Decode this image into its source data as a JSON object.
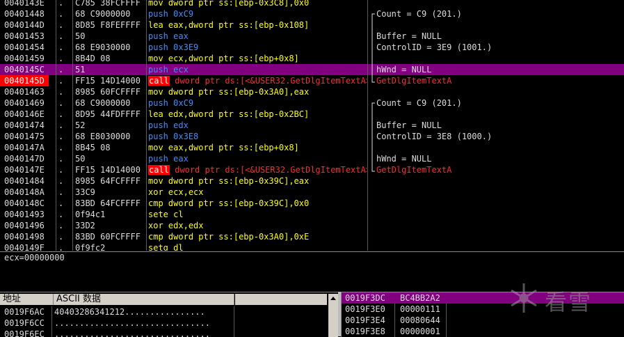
{
  "disasm": {
    "rows": [
      {
        "addr": "0040143E",
        "mark": ".",
        "hex": "C785 38FCFFFF",
        "op": "mov",
        "args": "dword ptr ss:[ebp-0x3C8],0x0",
        "cls": "mov",
        "cmt": ""
      },
      {
        "addr": "00401448",
        "mark": ".",
        "hex": "68 C9000000",
        "op": "push",
        "args": "0xC9",
        "cls": "push",
        "cmt": "Count = C9 (201.)"
      },
      {
        "addr": "0040144D",
        "mark": ".",
        "hex": "8D85 F8FEFFFF",
        "op": "lea",
        "args": "eax,dword ptr ss:[ebp-0x108]",
        "cls": "mov",
        "cmt": ""
      },
      {
        "addr": "00401453",
        "mark": ".",
        "hex": "50",
        "op": "push",
        "args": "eax",
        "cls": "push",
        "cmt": "Buffer = NULL"
      },
      {
        "addr": "00401454",
        "mark": ".",
        "hex": "68 E9030000",
        "op": "push",
        "args": "0x3E9",
        "cls": "push",
        "cmt": "ControlID = 3E9 (1001.)"
      },
      {
        "addr": "00401459",
        "mark": ".",
        "hex": "8B4D 08",
        "op": "mov",
        "args": "ecx,dword ptr ss:[ebp+0x8]",
        "cls": "mov",
        "cmt": ""
      },
      {
        "addr": "0040145C",
        "mark": ".",
        "hex": "51",
        "op": "push",
        "args": "ecx",
        "cls": "push",
        "cmt": "hWnd = NULL"
      },
      {
        "addr": "0040145D",
        "mark": ".",
        "hex": "FF15 14D14000",
        "op": "call",
        "args": "dword ptr ds:[<&USER32.GetDlgItemTextA>]",
        "cls": "call",
        "cmt": "GetDlgItemTextA"
      },
      {
        "addr": "00401463",
        "mark": ".",
        "hex": "8985 60FCFFFF",
        "op": "mov",
        "args": "dword ptr ss:[ebp-0x3A0],eax",
        "cls": "mov",
        "cmt": ""
      },
      {
        "addr": "00401469",
        "mark": ".",
        "hex": "68 C9000000",
        "op": "push",
        "args": "0xC9",
        "cls": "push",
        "cmt": "Count = C9 (201.)"
      },
      {
        "addr": "0040146E",
        "mark": ".",
        "hex": "8D95 44FDFFFF",
        "op": "lea",
        "args": "edx,dword ptr ss:[ebp-0x2BC]",
        "cls": "mov",
        "cmt": ""
      },
      {
        "addr": "00401474",
        "mark": ".",
        "hex": "52",
        "op": "push",
        "args": "edx",
        "cls": "push",
        "cmt": "Buffer = NULL"
      },
      {
        "addr": "00401475",
        "mark": ".",
        "hex": "68 E8030000",
        "op": "push",
        "args": "0x3E8",
        "cls": "push",
        "cmt": "ControlID = 3E8 (1000.)"
      },
      {
        "addr": "0040147A",
        "mark": ".",
        "hex": "8B45 08",
        "op": "mov",
        "args": "eax,dword ptr ss:[ebp+0x8]",
        "cls": "mov",
        "cmt": ""
      },
      {
        "addr": "0040147D",
        "mark": ".",
        "hex": "50",
        "op": "push",
        "args": "eax",
        "cls": "push",
        "cmt": "hWnd = NULL"
      },
      {
        "addr": "0040147E",
        "mark": ".",
        "hex": "FF15 14D14000",
        "op": "call",
        "args": "dword ptr ds:[<&USER32.GetDlgItemTextA>]",
        "cls": "call",
        "cmt": "GetDlgItemTextA"
      },
      {
        "addr": "00401484",
        "mark": ".",
        "hex": "8985 64FCFFFF",
        "op": "mov",
        "args": "dword ptr ss:[ebp-0x39C],eax",
        "cls": "mov",
        "cmt": ""
      },
      {
        "addr": "0040148A",
        "mark": ".",
        "hex": "33C9",
        "op": "xor",
        "args": "ecx,ecx",
        "cls": "mov",
        "cmt": ""
      },
      {
        "addr": "0040148C",
        "mark": ".",
        "hex": "83BD 64FCFFFF",
        "op": "cmp",
        "args": "dword ptr ss:[ebp-0x39C],0x0",
        "cls": "mov",
        "cmt": ""
      },
      {
        "addr": "00401493",
        "mark": ".",
        "hex": "0f94c1",
        "op": "sete",
        "args": "cl",
        "cls": "mov",
        "cmt": ""
      },
      {
        "addr": "00401496",
        "mark": ".",
        "hex": "33D2",
        "op": "xor",
        "args": "edx,edx",
        "cls": "mov",
        "cmt": ""
      },
      {
        "addr": "00401498",
        "mark": ".",
        "hex": "83BD 60FCFFFF",
        "op": "cmp",
        "args": "dword ptr ss:[ebp-0x3A0],0xE",
        "cls": "mov",
        "cmt": ""
      },
      {
        "addr": "0040149F",
        "mark": ".",
        "hex": "0f9fc2",
        "op": "setg",
        "args": "dl",
        "cls": "mov",
        "cmt": ""
      }
    ],
    "selected_index": 6,
    "breakpoint_index": 7
  },
  "info": {
    "text": "ecx=00000000"
  },
  "dump": {
    "header_addr": "地址",
    "header_ascii": "ASCII 数据",
    "rows": [
      {
        "addr": "0019F6AC",
        "ascii": "40403286341212................"
      },
      {
        "addr": "0019F6CC",
        "ascii": "..............................."
      },
      {
        "addr": "0019F6EC",
        "ascii": "..............................."
      }
    ]
  },
  "stack": {
    "rows": [
      {
        "addr": "0019F3DC",
        "val": "BC4BB2A2"
      },
      {
        "addr": "0019F3E0",
        "val": "00000111"
      },
      {
        "addr": "0019F3E4",
        "val": "00080644"
      },
      {
        "addr": "0019F3E8",
        "val": "00000001"
      }
    ],
    "selected_index": 0
  },
  "watermark": {
    "text": "看雪",
    "icon": "snowflake-icon"
  },
  "colors": {
    "selection": "#800080",
    "breakpoint": "#ff0000",
    "push": "#3f8cff",
    "mov": "#ffff00",
    "api": "#ff2a2a"
  }
}
